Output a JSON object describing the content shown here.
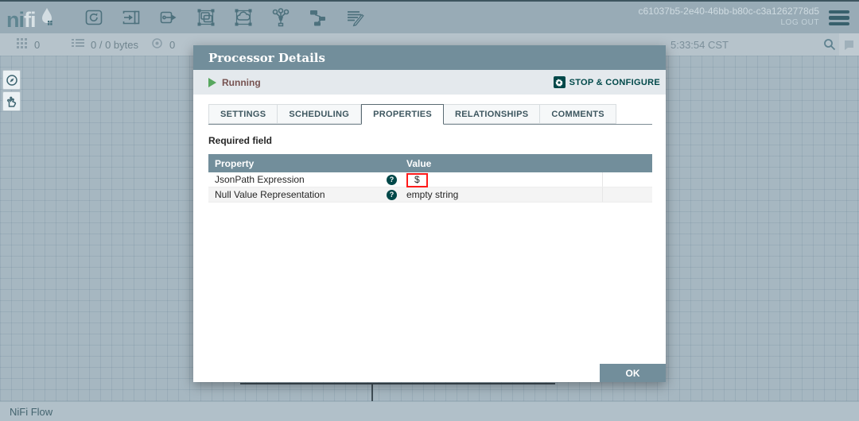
{
  "toolbar": {
    "logo_ni": "ni",
    "logo_fi": "fi",
    "uuid": "c61037b5-2e40-46bb-b80c-c3a1262778d5",
    "logout_label": "LOG OUT",
    "icons": [
      "processor",
      "input-port",
      "output-port",
      "process-group",
      "remote-process-group",
      "funnel",
      "template",
      "label"
    ]
  },
  "statusbar": {
    "active_threads": "0",
    "queued": "0 / 0 bytes",
    "transmitting": "0",
    "time": "5:33:54 CST"
  },
  "dialog": {
    "title": "Processor Details",
    "state_label": "Running",
    "stop_configure_label": "STOP & CONFIGURE",
    "tabs": [
      "SETTINGS",
      "SCHEDULING",
      "PROPERTIES",
      "RELATIONSHIPS",
      "COMMENTS"
    ],
    "active_tab": "PROPERTIES",
    "required_note": "Required field",
    "table": {
      "property_header": "Property",
      "value_header": "Value",
      "help_glyph": "?",
      "rows": [
        {
          "property": "JsonPath Expression",
          "value": "$",
          "highlighted": true
        },
        {
          "property": "Null Value Representation",
          "value": "empty string",
          "highlighted": false
        }
      ]
    },
    "ok_label": "OK"
  },
  "breadcrumb": "NiFi Flow",
  "colors": {
    "accent": "#728e9b",
    "teal": "#004849",
    "running_green": "#57a75f",
    "highlight_red": "#ff1a1a",
    "canvas": "#a6b7c1"
  }
}
